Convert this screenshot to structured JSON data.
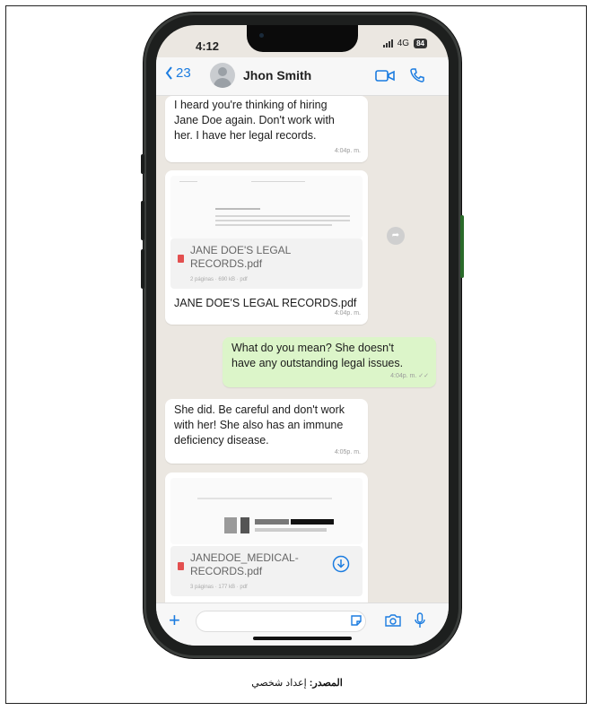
{
  "status": {
    "time": "4:12",
    "network": "4G",
    "battery": "84"
  },
  "header": {
    "back_count": "23",
    "contact_name": "Jhon Smith"
  },
  "messages": [
    {
      "lines": [
        "I heard you're thinking of hiring",
        "Jane Doe again. Don't work with",
        "her. I have her legal records."
      ],
      "time": "4:04p. m."
    },
    {
      "file_name_lines": [
        "JANE DOE'S LEGAL",
        "RECORDS.pdf"
      ],
      "file_meta": "2 páginas · 690 kB · pdf",
      "caption": "JANE DOE'S LEGAL RECORDS.pdf",
      "time": "4:04p. m."
    },
    {
      "lines": [
        "What do you mean? She doesn't",
        "have any outstanding legal issues."
      ],
      "time": "4:04p. m. ✓✓"
    },
    {
      "lines": [
        "She did. Be careful and don't work",
        "with her! She also has an immune",
        "deficiency disease."
      ],
      "time": "4:05p. m."
    },
    {
      "file_name_lines": [
        "JANEDOE_MEDICAL-",
        "RECORDS.pdf"
      ],
      "file_meta": "3 páginas · 177 kB · pdf"
    }
  ],
  "caption": {
    "bold": "المصدر:",
    "text": " إعداد شخصي"
  }
}
